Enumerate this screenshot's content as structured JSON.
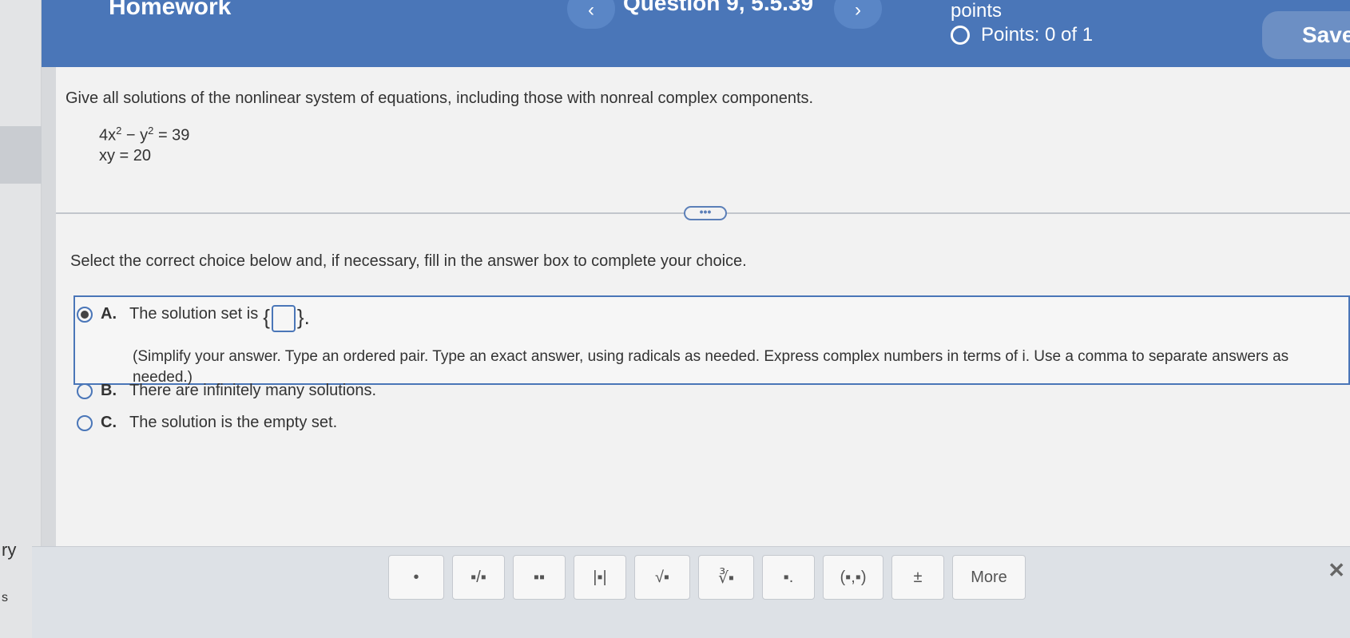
{
  "header": {
    "title": "Homework",
    "question": "Question 9, 5.5.39",
    "prev_glyph": "‹",
    "next_glyph": "›",
    "points_label": "points",
    "points": "Points: 0 of 1",
    "save_label": "Save",
    "bg_color": "#4a76b8"
  },
  "sidebar": {
    "fragment_1": "ry",
    "fragment_2": "s"
  },
  "question": {
    "prompt": "Give all solutions of the nonlinear system of equations, including those with nonreal complex components.",
    "eq1_a": "4x",
    "eq1_exp1": "2",
    "eq1_b": " − y",
    "eq1_exp2": "2",
    "eq1_c": " = 39",
    "eq2": "xy = 20",
    "more_glyph": "•••"
  },
  "instruction": "Select the correct choice below and, if necessary, fill in the answer box to complete your choice.",
  "choices": [
    {
      "letter": "A.",
      "text": "The solution set is",
      "brace_open": "{",
      "brace_close": "}.",
      "selected": true
    },
    {
      "letter": "B.",
      "text": "There are infinitely many solutions.",
      "selected": false
    },
    {
      "letter": "C.",
      "text": "The solution is the empty set.",
      "selected": false
    }
  ],
  "hint": "(Simplify your answer. Type an ordered pair. Type an exact answer, using radicals as needed. Express complex numbers in terms of i. Use a comma to separate answers as needed.)",
  "toolbar": {
    "buttons": [
      {
        "label": "•",
        "icon": "dot-icon"
      },
      {
        "label": "▪/▪",
        "icon": "fraction-icon"
      },
      {
        "label": "▪▪",
        "icon": "exponent-icon"
      },
      {
        "label": "|▪|",
        "icon": "absolute-value-icon"
      },
      {
        "label": "√▪",
        "icon": "square-root-icon"
      },
      {
        "label": "∛▪",
        "icon": "nth-root-icon"
      },
      {
        "label": "▪.",
        "icon": "subscript-icon"
      },
      {
        "label": "(▪,▪)",
        "icon": "ordered-pair-icon"
      },
      {
        "label": "±",
        "icon": "plus-minus-icon"
      },
      {
        "label": "More",
        "icon": "more-icon"
      }
    ],
    "close_glyph": "✕"
  }
}
